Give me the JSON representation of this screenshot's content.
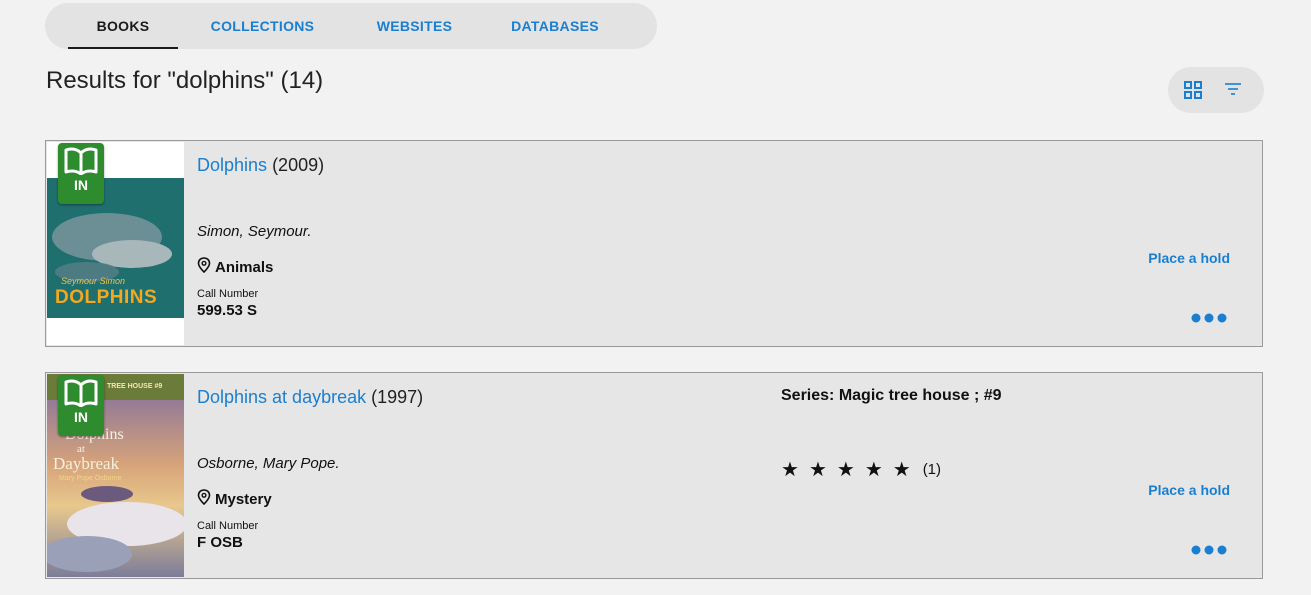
{
  "tabs": [
    {
      "label": "BOOKS",
      "active": true
    },
    {
      "label": "COLLECTIONS",
      "active": false
    },
    {
      "label": "WEBSITES",
      "active": false
    },
    {
      "label": "DATABASES",
      "active": false
    }
  ],
  "results": {
    "title": "Results for \"dolphins\" (14)"
  },
  "view_controls": {
    "grid_icon": "grid-icon",
    "filter_icon": "filter-icon"
  },
  "books": [
    {
      "title": "Dolphins",
      "year": "(2009)",
      "author": "Simon, Seymour.",
      "location": "Animals",
      "call_label": "Call Number",
      "call_number": "599.53 S",
      "badge": "IN",
      "hold": "Place a hold",
      "cover_text_small": "Seymour Simon",
      "cover_text_big": "DOLPHINS"
    },
    {
      "title": "Dolphins at daybreak",
      "year": "(1997)",
      "author": "Osborne, Mary Pope.",
      "location": "Mystery",
      "call_label": "Call Number",
      "call_number": "F OSB",
      "badge": "IN",
      "hold": "Place a hold",
      "series": "Series: Magic tree house ; #9",
      "stars": "★",
      "rating": 5,
      "rating_count": "(1)",
      "cover_text_top": "TREE HOUSE #9",
      "cover_text_mid": "Dolphins",
      "cover_text_at": "at",
      "cover_text_big": "Daybreak",
      "cover_text_small": "Mary Pope Osborne"
    }
  ],
  "colors": {
    "link": "#1a7fd0",
    "badge": "#2e8b2e",
    "card_bg": "#e6e6e6"
  }
}
